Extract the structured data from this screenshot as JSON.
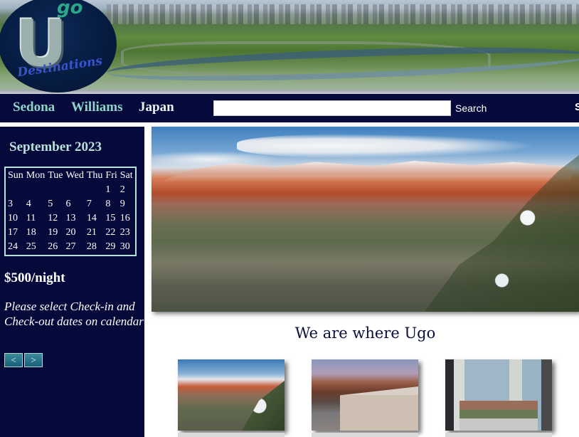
{
  "logo": {
    "letter": "U",
    "go": "go",
    "destinations": "Destinations"
  },
  "nav": {
    "links": [
      "Sedona",
      "Williams",
      "Japan"
    ],
    "search_placeholder": "",
    "search_button": "Search",
    "overflow": "S"
  },
  "calendar": {
    "title": "September 2023",
    "weekdays": [
      "Sun",
      "Mon",
      "Tue",
      "Wed",
      "Thu",
      "Fri",
      "Sat"
    ],
    "weeks": [
      [
        "",
        "",
        "",
        "",
        "",
        "1",
        "2"
      ],
      [
        "3",
        "4",
        "5",
        "6",
        "7",
        "8",
        "9"
      ],
      [
        "10",
        "11",
        "12",
        "13",
        "14",
        "15",
        "16"
      ],
      [
        "17",
        "18",
        "19",
        "20",
        "21",
        "22",
        "23"
      ],
      [
        "24",
        "25",
        "26",
        "27",
        "28",
        "29",
        "30"
      ]
    ],
    "prev_label": "<",
    "next_label": ">"
  },
  "booking": {
    "price": "$500/night",
    "instructions": "Please select Check-in and Check-out dates on calendar"
  },
  "main": {
    "tagline": "We are where Ugo"
  },
  "colors": {
    "nav_bg": "#050a3a",
    "nav_link": "#8fd4c8",
    "calendar_border": "#b9e0d9"
  }
}
